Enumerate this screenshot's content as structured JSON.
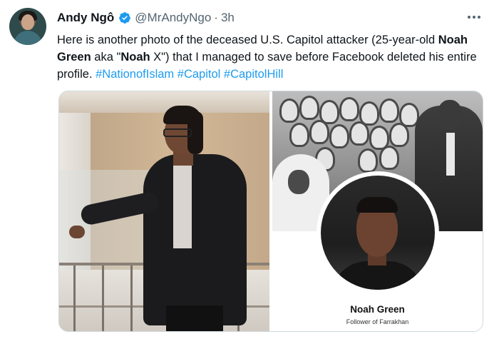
{
  "tweet": {
    "author_name": "Andy Ngô",
    "handle": "@MrAndyNgo",
    "separator": "·",
    "time": "3h",
    "text": {
      "p1": "Here is another photo of the deceased U.S. Capitol attacker (25-year-old ",
      "b1": "Noah Green",
      "p2": " aka \"",
      "b2": "Noah",
      "p3": " X\") that I managed to save before Facebook deleted his entire profile. ",
      "hashtags": [
        "#NationofIslam",
        "#Capitol",
        "#CapitolHill"
      ]
    }
  },
  "media": {
    "profile_name": "Noah Green",
    "profile_subtitle": "Follower of Farrakhan"
  },
  "colors": {
    "link": "#1d9bf0",
    "verified": "#1d9bf0",
    "secondary_text": "#536471",
    "border": "#cfd9de"
  },
  "icons": {
    "verified": "verified-badge-icon",
    "more": "more-options-icon"
  }
}
